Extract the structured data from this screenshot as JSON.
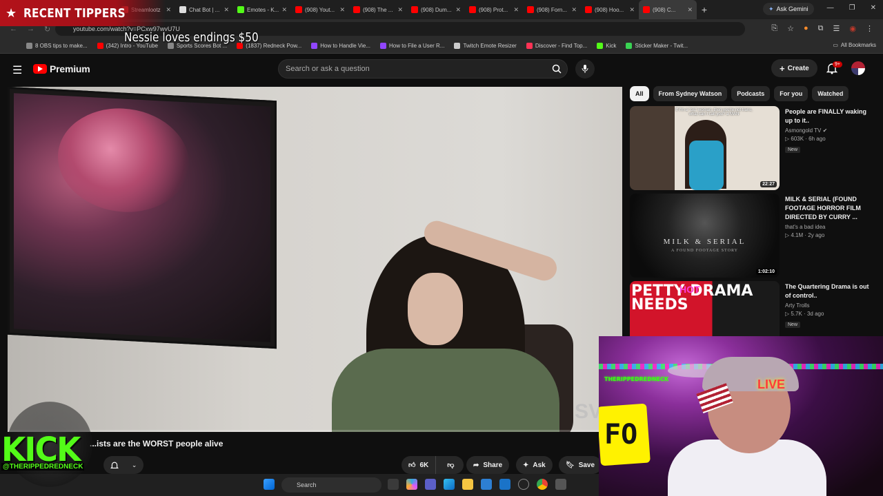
{
  "overlay": {
    "tippers_title": "RECENT TIPPERS",
    "tip_message": "Nessie loves endings $50",
    "kick_logo": "KICK",
    "kick_handle": "@THERIPPEDREDNECK",
    "cam_sign": "THERIPPEDREDNECK",
    "cam_live": "LIVE",
    "cam_fo": "FO"
  },
  "browser": {
    "tabs": [
      {
        "label": "Streamlootz",
        "color": "#ff4444"
      },
      {
        "label": "Chat Bot | ...",
        "color": "#dddddd"
      },
      {
        "label": "Emotes - K...",
        "color": "#53fc18"
      },
      {
        "label": "(908) Yout...",
        "color": "#ff0000"
      },
      {
        "label": "(908) The ...",
        "color": "#ff0000"
      },
      {
        "label": "(908) Dum...",
        "color": "#ff0000"
      },
      {
        "label": "(908) Prot...",
        "color": "#ff0000"
      },
      {
        "label": "(908) Forn...",
        "color": "#ff0000"
      },
      {
        "label": "(908) Hoo...",
        "color": "#ff0000"
      },
      {
        "label": "(908) C...",
        "color": "#ff0000"
      }
    ],
    "ask_gemini": "Ask Gemini",
    "url": "youtube.com/watch?v=PCxw97wvU7U",
    "bookmarks": [
      {
        "label": "8 OBS tips to make...",
        "color": "#888888"
      },
      {
        "label": "(342) Intro - YouTube",
        "color": "#ff0000"
      },
      {
        "label": "Sports Scores Bot ...",
        "color": "#888888"
      },
      {
        "label": "(1837) Redneck Pow...",
        "color": "#ff0000"
      },
      {
        "label": "How to Handle Vie...",
        "color": "#9146ff"
      },
      {
        "label": "How to File a User R...",
        "color": "#9146ff"
      },
      {
        "label": "Twitch Emote Resizer",
        "color": "#cccccc"
      },
      {
        "label": "Discover - Find Top...",
        "color": "#ff3355"
      },
      {
        "label": "Kick",
        "color": "#53fc18"
      },
      {
        "label": "Sticker Maker - Twit...",
        "color": "#39d353"
      }
    ],
    "all_bookmarks": "All Bookmarks"
  },
  "youtube": {
    "brand": "Premium",
    "search_placeholder": "Search or ask a question",
    "create_label": "Create",
    "notif_count": "9+",
    "video_title": "...ists are the WORST people alive",
    "watermark": "SV",
    "progress_fraction": 0.0,
    "likes": "6K",
    "share_label": "Share",
    "ask_label": "Ask",
    "save_label": "Save",
    "chips": [
      "All",
      "From Sydney Watson",
      "Podcasts",
      "For you",
      "Watched"
    ],
    "recommended": [
      {
        "title": "People are FINALLY waking up to it..",
        "channel": "Asmongold TV",
        "stats": "▷ 603K · 6h ago",
        "badge": "New",
        "duration": "22:27",
        "thumb_caption": "If I'm a \"cis\" woman, then you're not trans, what can I call you? a MAN"
      },
      {
        "title": "MILK & SERIAL (FOUND FOOTAGE HORROR FILM DIRECTED BY CURRY ...",
        "channel": "that's a bad idea",
        "stats": "▷ 4.1M · 2y ago",
        "badge": "",
        "duration": "1:02:10",
        "thumb_caption": "MILK & SERIAL",
        "thumb_sub": "A FOUND FOOTAGE STORY"
      },
      {
        "title": "The Quartering Drama is out of control..",
        "channel": "Arty Trolls",
        "stats": "▷ 5.7K · 3d ago",
        "badge": "New",
        "duration": "",
        "thumb_caption": "PETTY DRAMA NEEDS",
        "thumb_sub": "HOT"
      }
    ]
  },
  "taskbar": {
    "search_label": "Search"
  }
}
